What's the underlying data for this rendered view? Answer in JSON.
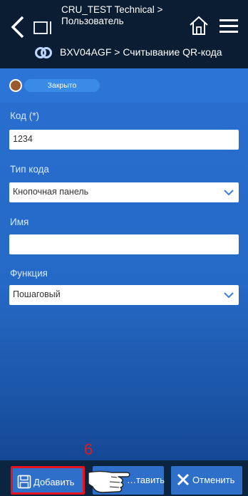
{
  "header": {
    "title_line1": "CRU_TEST Technical >",
    "title_line2": "Пользователь",
    "breadcrumb": "BXV04AGF > Считывание QR-кода"
  },
  "status": {
    "label": "Закрыто",
    "dot_color": "#9a5a2c"
  },
  "form": {
    "code_label": "Код (*)",
    "code_value": "1234",
    "code_type_label": "Тип кода",
    "code_type_value": "Кнопочная панель",
    "name_label": "Имя",
    "name_value": "",
    "function_label": "Функция",
    "function_value": "Пошаговый"
  },
  "toolbar": {
    "add_label": "Добавить",
    "save_label": "…тавить",
    "cancel_label": "Отменить"
  },
  "annotation": {
    "step_number": "6"
  },
  "colors": {
    "accent": "#2c75d6",
    "highlight": "#e8121e",
    "header_bg": "#0b1d33"
  }
}
